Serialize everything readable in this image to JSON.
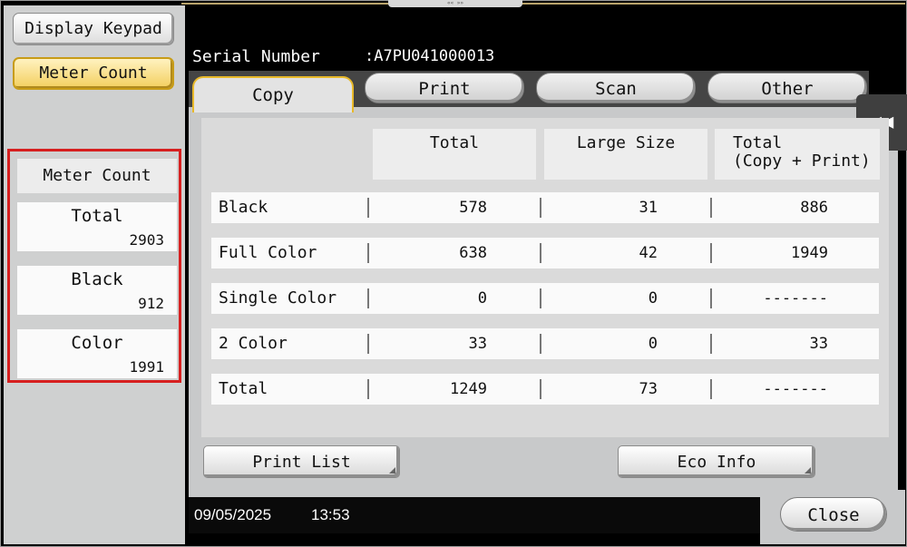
{
  "left": {
    "display_keypad": "Display Keypad",
    "meter_count_btn": "Meter Count",
    "meter_panel": {
      "title": "Meter Count",
      "cards": [
        {
          "label": "Total",
          "value": "2903"
        },
        {
          "label": "Black",
          "value": "912"
        },
        {
          "label": "Color",
          "value": "1991"
        }
      ]
    }
  },
  "header": {
    "serial_label": "Serial Number",
    "serial_value": ":A7PU041000013",
    "notch": "«« »»"
  },
  "tabs": [
    "Copy",
    "Print",
    "Scan",
    "Other"
  ],
  "side_arrow": "◀◀",
  "table": {
    "columns": [
      "Total",
      "Large Size",
      "Total\n(Copy + Print)"
    ],
    "rows": [
      {
        "label": "Black",
        "total": "578",
        "large": "31",
        "combined": "886"
      },
      {
        "label": "Full Color",
        "total": "638",
        "large": "42",
        "combined": "1949"
      },
      {
        "label": "Single Color",
        "total": "0",
        "large": "0",
        "combined": "-------"
      },
      {
        "label": "2 Color",
        "total": "33",
        "large": "0",
        "combined": "33"
      },
      {
        "label": "Total",
        "total": "1249",
        "large": "73",
        "combined": "-------"
      }
    ]
  },
  "footer": {
    "print_list": "Print List",
    "eco_info": "Eco Info",
    "date": "09/05/2025",
    "time": "13:53",
    "close": "Close"
  },
  "colors": {
    "active_tab_border": "#e8b92a",
    "highlight_box": "#d61f1f",
    "panel_bg": "#c8c9ca"
  }
}
